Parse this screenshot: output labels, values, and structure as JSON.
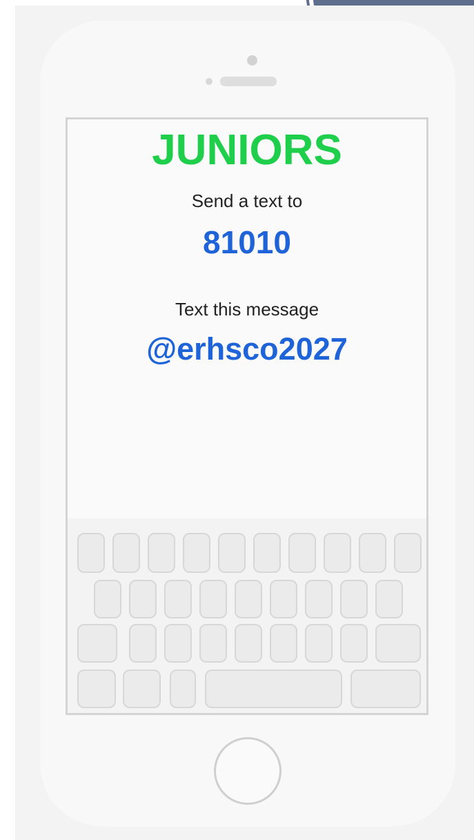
{
  "screen": {
    "title": "JUNIORS",
    "send_label": "Send a text to",
    "number": "81010",
    "message_label": "Text this message",
    "code": "@erhsco2027"
  },
  "colors": {
    "title": "#1fcf4b",
    "highlight": "#1e63d8",
    "text": "#222222"
  },
  "icons": {
    "home": "home-button-circle",
    "camera": "camera-dot"
  }
}
